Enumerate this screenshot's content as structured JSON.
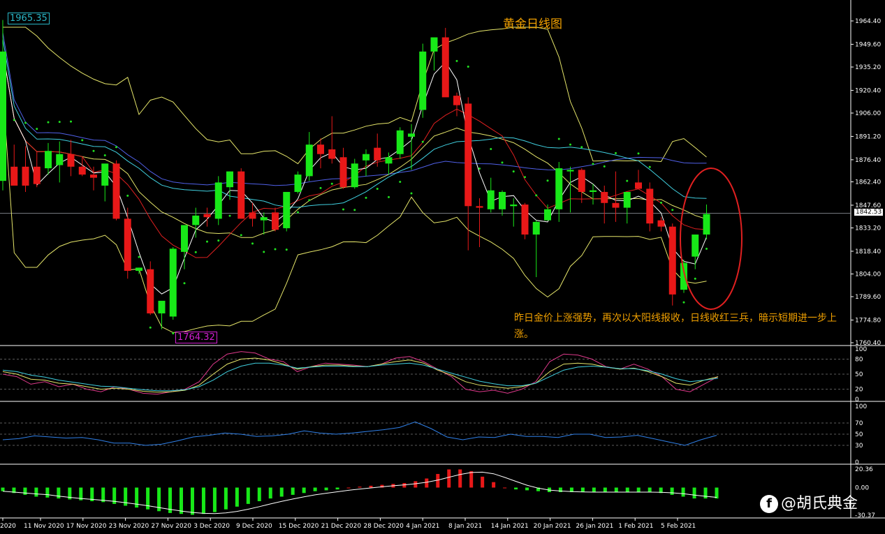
{
  "title": "黄金日线图",
  "annotation": "昨日金价上涨强势，再次以大阳线报收，日线收红三兵，暗示短期进一步上涨。",
  "high_label": "1965.35",
  "low_label": "1764.32",
  "current_price": "1842.53",
  "watermark": "@胡氏典金",
  "colors": {
    "bull": "#18e818",
    "bear": "#e81818",
    "bb": "#e6e66a",
    "ma_white": "#ffffff",
    "ma_red": "#e02020",
    "ma_cyan": "#40d0e0",
    "ma_blue": "#5060e8",
    "sar": "#20e020",
    "rsi_blue": "#3080e8"
  },
  "x_labels": [
    "2020",
    "11 Nov 2020",
    "17 Nov 2020",
    "23 Nov 2020",
    "27 Nov 2020",
    "3 Dec 2020",
    "9 Dec 2020",
    "15 Dec 2020",
    "21 Dec 2020",
    "28 Dec 2020",
    "4 Jan 2021",
    "8 Jan 2021",
    "14 Jan 2021",
    "20 Jan 2021",
    "26 Jan 2021",
    "1 Feb 2021",
    "5 Feb 2021"
  ],
  "chart_data": [
    {
      "type": "candlestick",
      "title": "黄金日线图",
      "y_ticks": [
        "1964.40",
        "1949.60",
        "1935.20",
        "1920.40",
        "1906.00",
        "1891.20",
        "1876.40",
        "1862.40",
        "1847.60",
        "1833.20",
        "1818.40",
        "1804.00",
        "1789.60",
        "1774.80",
        "1760.40"
      ],
      "ylim": [
        1760.4,
        1964.4
      ],
      "candles": [
        [
          1863,
          1965,
          1857,
          1945
        ],
        [
          1872,
          1886,
          1864,
          1860
        ],
        [
          1872,
          1885,
          1856,
          1860
        ],
        [
          1872,
          1882,
          1859,
          1861
        ],
        [
          1871,
          1887,
          1867,
          1882
        ],
        [
          1873,
          1888,
          1862,
          1880
        ],
        [
          1880,
          1889,
          1866,
          1872
        ],
        [
          1872,
          1878,
          1866,
          1867
        ],
        [
          1867,
          1872,
          1857,
          1865
        ],
        [
          1860,
          1870,
          1850,
          1874
        ],
        [
          1874,
          1876,
          1838,
          1839
        ],
        [
          1839,
          1846,
          1801,
          1806
        ],
        [
          1806,
          1808,
          1804,
          1808
        ],
        [
          1807,
          1812,
          1778,
          1779
        ],
        [
          1779,
          1784,
          1769,
          1787
        ],
        [
          1777,
          1821,
          1775,
          1820
        ],
        [
          1818,
          1834,
          1807,
          1835
        ],
        [
          1835,
          1846,
          1827,
          1841
        ],
        [
          1842,
          1846,
          1834,
          1840
        ],
        [
          1839,
          1866,
          1835,
          1862
        ],
        [
          1859,
          1869,
          1851,
          1869
        ],
        [
          1869,
          1871,
          1839,
          1839
        ],
        [
          1843,
          1849,
          1834,
          1839
        ],
        [
          1838,
          1843,
          1829,
          1840
        ],
        [
          1843,
          1846,
          1831,
          1832
        ],
        [
          1833,
          1854,
          1831,
          1856
        ],
        [
          1856,
          1869,
          1855,
          1867
        ],
        [
          1866,
          1894,
          1863,
          1886
        ],
        [
          1886,
          1890,
          1871,
          1880
        ],
        [
          1883,
          1904,
          1874,
          1877
        ],
        [
          1878,
          1884,
          1858,
          1859
        ],
        [
          1859,
          1877,
          1858,
          1874
        ],
        [
          1876,
          1883,
          1866,
          1880
        ],
        [
          1884,
          1893,
          1872,
          1876
        ],
        [
          1874,
          1881,
          1867,
          1878
        ],
        [
          1880,
          1897,
          1877,
          1895
        ],
        [
          1891,
          1899,
          1870,
          1893
        ],
        [
          1908,
          1950,
          1903,
          1945
        ],
        [
          1945,
          1951,
          1933,
          1954
        ],
        [
          1954,
          1960,
          1919,
          1916
        ],
        [
          1917,
          1919,
          1904,
          1911
        ],
        [
          1912,
          1916,
          1819,
          1847
        ],
        [
          1847,
          1852,
          1821,
          1846
        ],
        [
          1845,
          1865,
          1843,
          1857
        ],
        [
          1845,
          1857,
          1841,
          1856
        ],
        [
          1847,
          1852,
          1834,
          1848
        ],
        [
          1848,
          1849,
          1826,
          1829
        ],
        [
          1829,
          1838,
          1802,
          1837
        ],
        [
          1838,
          1848,
          1838,
          1845
        ],
        [
          1845,
          1875,
          1837,
          1871
        ],
        [
          1869,
          1872,
          1843,
          1870
        ],
        [
          1870,
          1871,
          1849,
          1856
        ],
        [
          1856,
          1861,
          1848,
          1857
        ],
        [
          1856,
          1860,
          1836,
          1849
        ],
        [
          1849,
          1869,
          1837,
          1846
        ],
        [
          1846,
          1852,
          1836,
          1856
        ],
        [
          1862,
          1870,
          1861,
          1858
        ],
        [
          1858,
          1862,
          1831,
          1836
        ],
        [
          1838,
          1840,
          1831,
          1834
        ],
        [
          1834,
          1836,
          1784,
          1791
        ],
        [
          1794,
          1813,
          1792,
          1811
        ],
        [
          1815,
          1828,
          1807,
          1829
        ],
        [
          1829,
          1848,
          1826,
          1842
        ]
      ],
      "overlays": [
        "Bollinger Bands",
        "Moving Averages",
        "Parabolic SAR"
      ]
    },
    {
      "type": "line",
      "name": "stochastic",
      "y_ticks": [
        "100",
        "80",
        "50",
        "20",
        "0"
      ],
      "ylim": [
        0,
        100
      ],
      "series": [
        {
          "values": [
            50,
            45,
            30,
            35,
            25,
            30,
            20,
            15,
            25,
            20,
            12,
            10,
            15,
            20,
            35,
            70,
            90,
            95,
            92,
            80,
            75,
            55,
            65,
            72,
            70,
            68,
            65,
            70,
            82,
            85,
            75,
            60,
            45,
            20,
            15,
            18,
            12,
            20,
            35,
            75,
            90,
            88,
            80,
            65,
            60,
            70,
            60,
            45,
            20,
            15,
            30,
            45
          ]
        },
        {
          "values": [
            55,
            50,
            40,
            38,
            32,
            30,
            25,
            20,
            22,
            20,
            16,
            14,
            15,
            18,
            28,
            50,
            70,
            80,
            82,
            78,
            70,
            60,
            65,
            68,
            68,
            66,
            65,
            70,
            75,
            78,
            72,
            58,
            48,
            35,
            28,
            25,
            22,
            25,
            32,
            55,
            70,
            72,
            70,
            64,
            60,
            62,
            55,
            45,
            32,
            28,
            38,
            45
          ]
        },
        {
          "values": [
            58,
            55,
            48,
            44,
            38,
            34,
            30,
            26,
            25,
            22,
            19,
            17,
            17,
            19,
            25,
            38,
            55,
            66,
            72,
            72,
            68,
            62,
            64,
            66,
            66,
            65,
            65,
            68,
            70,
            72,
            68,
            60,
            52,
            44,
            36,
            31,
            27,
            27,
            32,
            45,
            58,
            64,
            66,
            64,
            61,
            61,
            57,
            50,
            41,
            35,
            38,
            42
          ]
        }
      ]
    },
    {
      "type": "line",
      "name": "rsi",
      "y_ticks": [
        "100",
        "70",
        "50",
        "30",
        "0"
      ],
      "ylim": [
        0,
        100
      ],
      "series": [
        {
          "values": [
            40,
            42,
            47,
            45,
            43,
            44,
            40,
            34,
            34,
            30,
            32,
            38,
            45,
            48,
            52,
            50,
            46,
            47,
            50,
            56,
            52,
            50,
            52,
            55,
            58,
            62,
            72,
            60,
            45,
            40,
            45,
            44,
            50,
            46,
            46,
            44,
            50,
            50,
            44,
            45,
            48,
            42,
            36,
            30,
            40,
            48
          ]
        }
      ]
    },
    {
      "type": "bar",
      "name": "macd_histogram",
      "y_ticks": [
        "20.36",
        "0.00",
        "-30.37"
      ],
      "ylim": [
        -30.37,
        20.36
      ],
      "values": [
        -4,
        -6,
        -8,
        -10,
        -11,
        -12,
        -13,
        -14,
        -15,
        -16,
        -18,
        -20,
        -22,
        -24,
        -26,
        -28,
        -29,
        -30,
        -29,
        -27,
        -24,
        -21,
        -18,
        -15,
        -12,
        -10,
        -8,
        -6,
        -4,
        -3,
        -2,
        0,
        1,
        2,
        3,
        4,
        5,
        7,
        10,
        15,
        20,
        20,
        18,
        12,
        6,
        0,
        -2,
        -3,
        -4,
        -5,
        -5,
        -5,
        -5,
        -5,
        -5,
        -5,
        -5,
        -5,
        -5,
        -6,
        -8,
        -10,
        -12,
        -12,
        -12
      ]
    }
  ]
}
